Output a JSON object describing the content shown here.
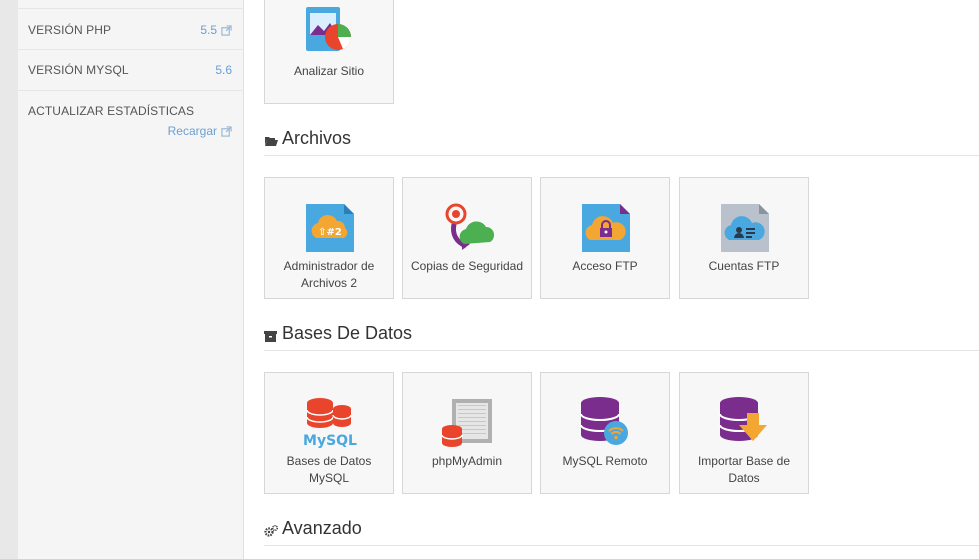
{
  "sidebar": {
    "stats": [
      {
        "label": "VERSIÓN PHP",
        "value": "5.5"
      },
      {
        "label": "VERSIÓN MYSQL",
        "value": "5.6"
      },
      {
        "label": "ACTUALIZAR ESTADÍSTICAS",
        "value": "Recargar"
      }
    ],
    "link_color": "#6a9fd4"
  },
  "main": {
    "top_card": {
      "label": "Analizar Sitio",
      "icon": "analyze-site-icon"
    },
    "sections": [
      {
        "title": "Archivos",
        "icon": "folder-open-icon",
        "items": [
          {
            "label": "Administrador de Archivos 2",
            "icon": "file-manager-icon"
          },
          {
            "label": "Copias de Seguridad",
            "icon": "backup-icon"
          },
          {
            "label": "Acceso FTP",
            "icon": "ftp-access-icon"
          },
          {
            "label": "Cuentas FTP",
            "icon": "ftp-accounts-icon"
          }
        ]
      },
      {
        "title": "Bases De Datos",
        "icon": "archive-box-icon",
        "items": [
          {
            "label": "Bases de Datos MySQL",
            "icon": "mysql-databases-icon",
            "badge": "MySQL"
          },
          {
            "label": "phpMyAdmin",
            "icon": "phpmyadmin-icon"
          },
          {
            "label": "MySQL Remoto",
            "icon": "remote-mysql-icon"
          },
          {
            "label": "Importar Base de Datos",
            "icon": "import-database-icon"
          }
        ]
      },
      {
        "title": "Avanzado",
        "icon": "gears-icon",
        "items": []
      }
    ]
  },
  "colors": {
    "blue": "#4aa8e0",
    "orange": "#f3a632",
    "red": "#e8452c",
    "purple": "#7b2d8e",
    "green": "#4caf50"
  }
}
